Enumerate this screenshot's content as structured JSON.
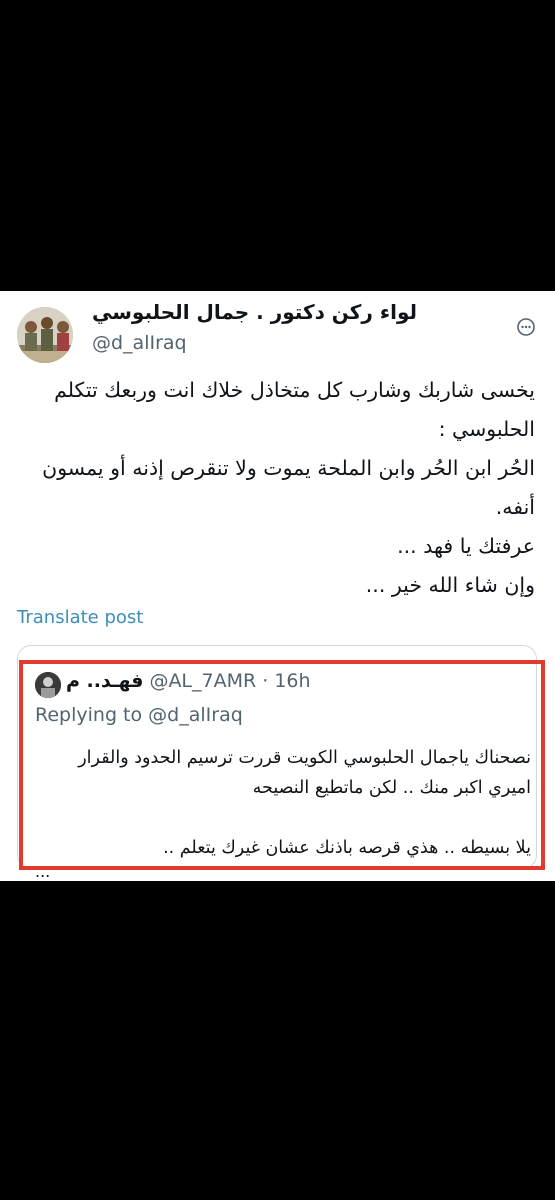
{
  "tweet": {
    "author_name": "لواء ركن دكتور . جمال الحلبوسي",
    "author_handle": "@d_alIraq",
    "text_lines": [
      "يخسى شاربك وشارب كل متخاذل خلاك انت وربعك تتكلم",
      "الحلبوسي :",
      "الحُر ابن الحُر وابن الملحة يموت ولا تنقرص إذنه أو يمسون",
      "أنفه.",
      "عرفتك يا فهد ...",
      "وإن شاء الله خير ..."
    ],
    "translate_label": "Translate post"
  },
  "quoted_tweet": {
    "author_name": "فهـد.. م",
    "handle_time": "@AL_7AMR · 16h",
    "replying_prefix": "Replying to",
    "replying_handle": "@d_alIraq",
    "text_lines": [
      "نصحناك ياجمال الحلبوسي الكويت قررت ترسيم الحدود والقرار",
      "اميري اكبر منك .. لكن ماتطيع النصيحه",
      "",
      "يلا بسيطه .. هذي قرصه باذنك عشان غيرك يتعلم .."
    ],
    "ellipsis": "..."
  },
  "colors": {
    "background": "#000000",
    "card": "#ffffff",
    "text": "#0f1419",
    "secondary": "#536471",
    "link": "#3d8fb9",
    "highlight_frame": "#e23b2e"
  },
  "icons": {
    "more": "more-horizontal-icon"
  }
}
